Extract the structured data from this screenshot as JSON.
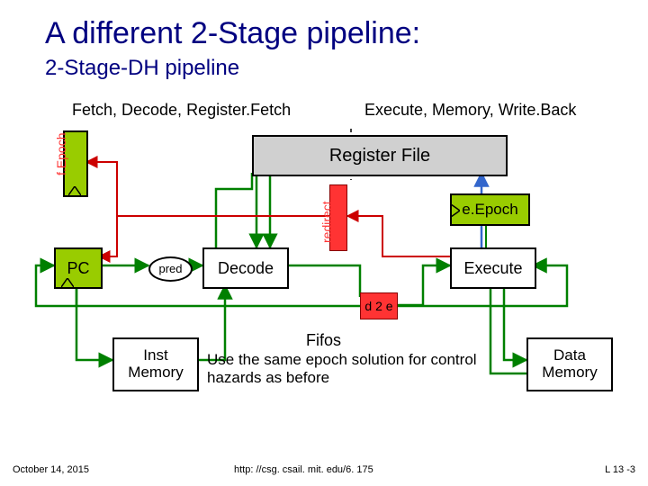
{
  "title": "A different 2-Stage pipeline:",
  "subtitle": "2-Stage-DH pipeline",
  "stages": {
    "left": "Fetch, Decode, Register.Fetch",
    "right": "Execute, Memory, Write.Back"
  },
  "blocks": {
    "regfile": "Register File",
    "pc": "PC",
    "pred": "pred",
    "decode": "Decode",
    "execute": "Execute",
    "eepoch": "e.Epoch",
    "d2e": "d 2 e",
    "instmem_l1": "Inst",
    "instmem_l2": "Memory",
    "datamem_l1": "Data",
    "datamem_l2": "Memory"
  },
  "labels": {
    "fepoch": "f.Epoch",
    "redirect": "redirect",
    "fifos": "Fifos",
    "epoch_note": "Use the same epoch solution for control hazards as before"
  },
  "footer": {
    "date": "October 14, 2015",
    "url": "http: //csg. csail. mit. edu/6. 175",
    "page": "L 13 -3"
  }
}
